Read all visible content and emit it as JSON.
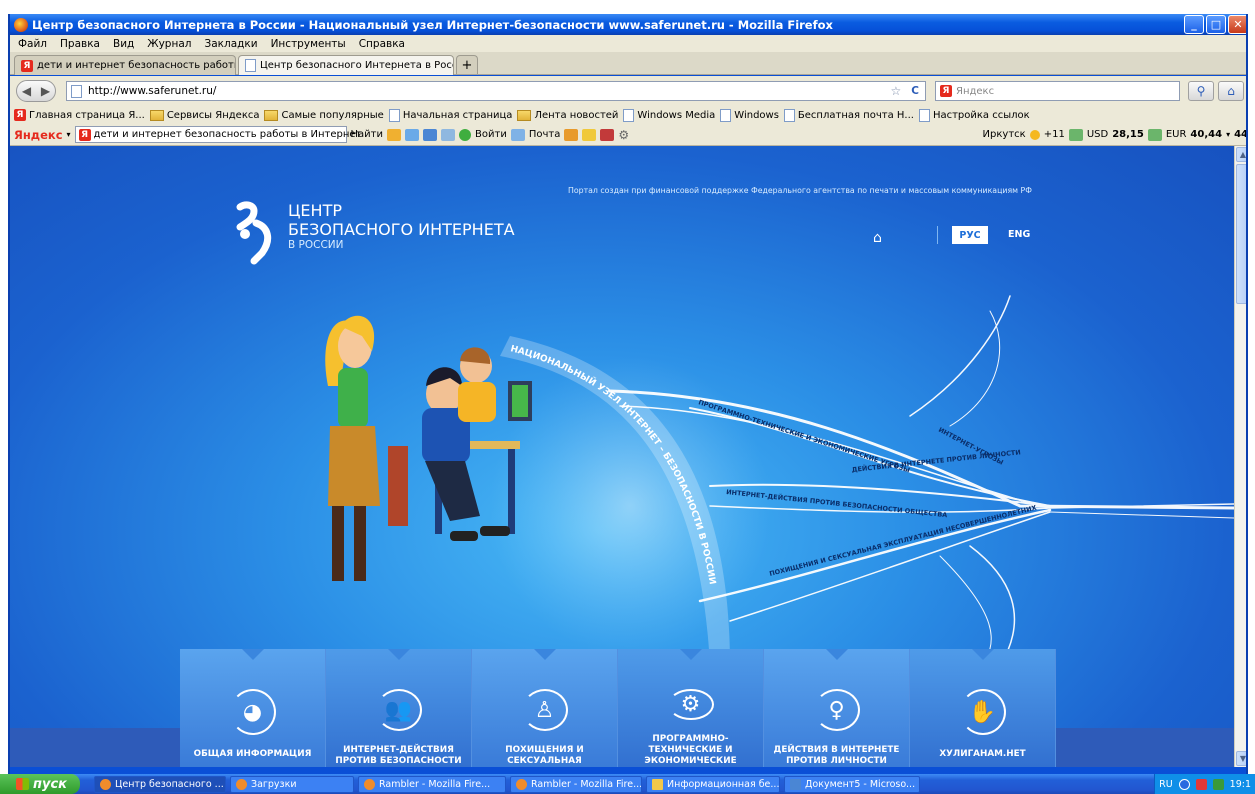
{
  "window": {
    "title": "Центр безопасного Интернета в России - Национальный узел Интернет-безопасности www.saferunet.ru - Mozilla Firefox"
  },
  "menu": [
    "Файл",
    "Правка",
    "Вид",
    "Журнал",
    "Закладки",
    "Инструменты",
    "Справка"
  ],
  "tabs": [
    {
      "label": "дети и интернет безопасность работы..."
    },
    {
      "label": "Центр безопасного Интернета в Росси..."
    }
  ],
  "navbar": {
    "url": "http://www.saferunet.ru/",
    "search_placeholder": "Яндекс"
  },
  "bookmarks": [
    "Главная страница Я...",
    "Сервисы Яндекса",
    "Самые популярные",
    "Начальная страница",
    "Лента новостей",
    "Windows Media",
    "Windows",
    "Бесплатная почта Н...",
    "Настройка ссылок"
  ],
  "yandex_bar": {
    "logo": "Яндекс",
    "query": "дети и интернет безопасность работы в Интернет",
    "find": "Найти",
    "login": "Войти",
    "mail": "Почта",
    "city": "Иркутск",
    "temp": "+11",
    "usd_label": "USD",
    "usd_value": "28,15",
    "eur_label": "EUR",
    "eur_value": "40,44",
    "extra": "44"
  },
  "page": {
    "portal_note": "Портал создан при финансовой поддержке Федерального агентства по печати и массовым коммуникациям РФ",
    "logo_line1": "ЦЕНТР",
    "logo_line2": "БЕЗОПАСНОГО ИНТЕРНЕТА",
    "logo_line3": "В РОССИИ",
    "lang_ru": "РУС",
    "lang_en": "ENG",
    "arc_text": "НАЦИОНАЛЬНЫЙ УЗЕЛ ИНТЕРНЕТ – БЕЗОПАСНОСТИ В РОССИИ",
    "threats": [
      "ПРОГРАММНО-ТЕХНИЧЕСКИЕ И ЭКОНОМИЧЕСКИЕ УГРОЗЫ",
      "ИНТЕРНЕТ-УГРОЗЫ",
      "ДЕЙСТВИЯ В ИНТЕРНЕТЕ ПРОТИВ ЛИЧНОСТИ",
      "ИНТЕРНЕТ-ДЕЙСТВИЯ ПРОТИВ БЕЗОПАСНОСТИ ОБЩЕСТВА",
      "ПОХИЩЕНИЯ И СЕКСУАЛЬНАЯ ЭКСПЛУАТАЦИЯ НЕСОВЕРШЕННОЛЕТНИХ"
    ],
    "nav_tiles": [
      {
        "label": "ОБЩАЯ ИНФОРМАЦИЯ",
        "icon": "globe-icon"
      },
      {
        "label": "ИНТЕРНЕТ-ДЕЙСТВИЯ ПРОТИВ БЕЗОПАСНОСТИ",
        "icon": "people-group-icon"
      },
      {
        "label": "ПОХИЩЕНИЯ И СЕКСУАЛЬНАЯ",
        "icon": "adult-child-icon"
      },
      {
        "label": "ПРОГРАММНО-ТЕХНИЧЕСКИЕ И ЭКОНОМИЧЕСКИЕ",
        "icon": "gear-icon"
      },
      {
        "label": "ДЕЙСТВИЯ В ИНТЕРНЕТЕ ПРОТИВ ЛИЧНОСТИ",
        "icon": "person-icon"
      },
      {
        "label": "ХУЛИГАНАМ.НЕТ",
        "icon": "handshake-icon"
      }
    ]
  },
  "taskbar": {
    "start": "пуск",
    "tasks": [
      "Центр безопасного ...",
      "Загрузки",
      "Rambler - Mozilla Fire...",
      "Rambler - Mozilla Fire...",
      "Информационная бе...",
      "Документ5 - Microso..."
    ],
    "lang": "RU",
    "clock": "19:1"
  }
}
